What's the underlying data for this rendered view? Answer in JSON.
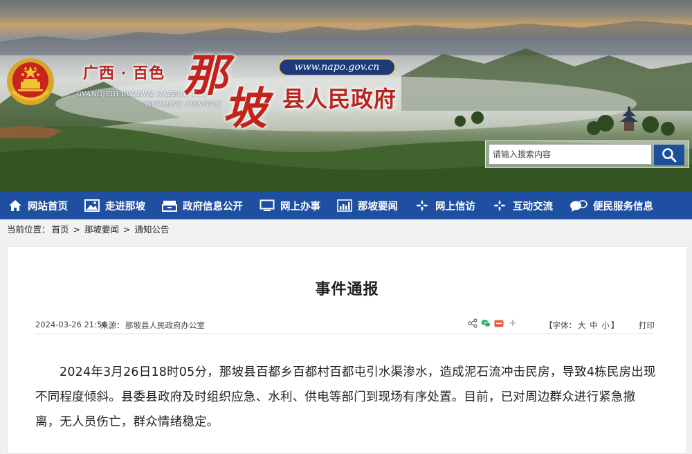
{
  "site": {
    "location": "广西 · 百色",
    "pinyin_line1": "GVANGJSIH BWZSWZ NAZBOH YEN",
    "pinyin_line2": "YINZMINZ CWNGFUJ",
    "county_char_1": "那",
    "county_char_2": "坡",
    "gov_title": "县人民政府",
    "url": "www.napo.gov.cn"
  },
  "search": {
    "placeholder": "请输入搜索内容"
  },
  "nav": {
    "items": [
      {
        "label": "网站首页",
        "icon": "home-icon"
      },
      {
        "label": "走进那坡",
        "icon": "picture-icon"
      },
      {
        "label": "政府信息公开",
        "icon": "drawer-icon"
      },
      {
        "label": "网上办事",
        "icon": "monitor-icon"
      },
      {
        "label": "那坡要闻",
        "icon": "bar-chart-icon"
      },
      {
        "label": "网上信访",
        "icon": "gear-icon"
      },
      {
        "label": "互动交流",
        "icon": "gear-icon"
      },
      {
        "label": "便民服务信息",
        "icon": "chat-icon"
      }
    ]
  },
  "breadcrumb": {
    "prefix": "当前位置：",
    "items": [
      "首页",
      "那坡要闻",
      "通知公告"
    ],
    "separator": ">"
  },
  "article": {
    "title": "事件通报",
    "date": "2024-03-26 21:56",
    "source_label": "来源：",
    "source": "那坡县人民政府办公室",
    "font_label": "【字体：",
    "font_sizes": [
      "大",
      "中",
      "小"
    ],
    "font_close": "】",
    "print_label": "打印",
    "body": "2024年3月26日18时05分，那坡县百都乡百都村百都屯引水渠渗水，造成泥石流冲击民房，导致4栋民房出现不同程度倾斜。县委县政府及时组织应急、水利、供电等部门到现场有序处置。目前，已对周边群众进行紧急撤离，无人员伤亡，群众情绪稳定。"
  },
  "colors": {
    "nav_bg": "#1f4fa0",
    "title_red": "#b6241e",
    "search_button": "#1e4f9b"
  }
}
